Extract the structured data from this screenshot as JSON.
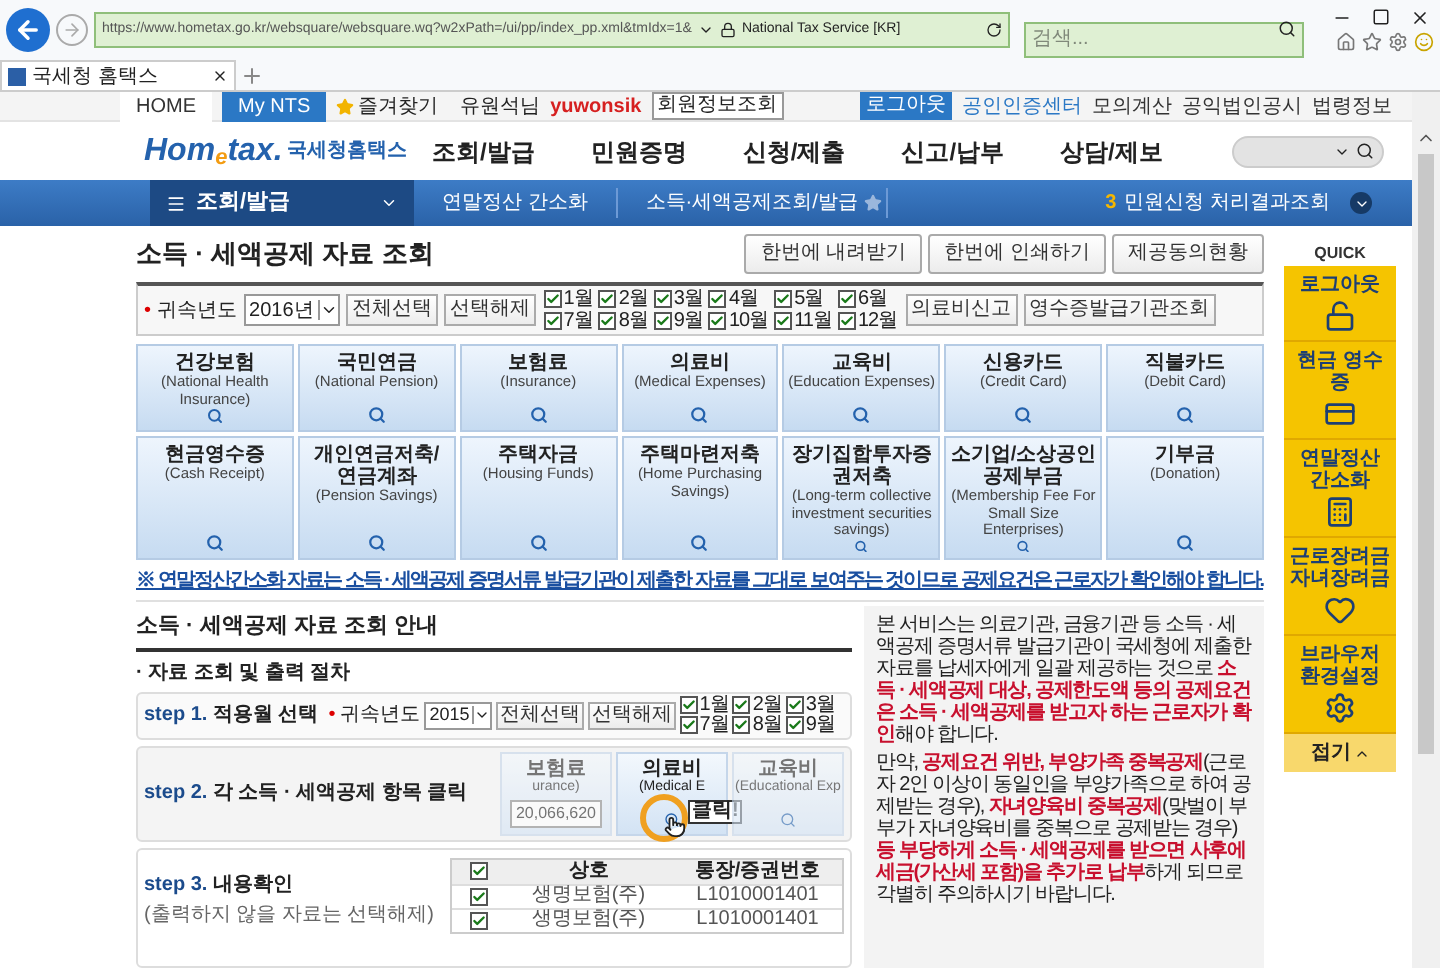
{
  "browser": {
    "url": "https://www.hometax.go.kr/websquare/websquare.wq?w2xPath=/ui/pp/index_pp.xml&tmIdx=1&",
    "site_identity": "National Tax Service [KR]",
    "search": {
      "placeholder": "검색..."
    },
    "tab": {
      "title": "국세청 홈택스"
    }
  },
  "top_bar": {
    "tabs": [
      {
        "label": "HOME",
        "selected": false
      },
      {
        "label": "My NTS",
        "selected": true
      }
    ],
    "favorites": "즐겨찾기",
    "user_name": "유원석님",
    "user_id": "yuwonsik",
    "profile_button": "회원정보조회",
    "logout_button": "로그아웃",
    "links": [
      "공인인증센터",
      "모의계산",
      "공익법인공시",
      "법령정보"
    ]
  },
  "header": {
    "logo": "Hom$_{e}$tax.",
    "logo_sub": "국세청홈택스",
    "menu": [
      "조회/발급",
      "민원증명",
      "신청/제출",
      "신고/납부",
      "상담/제보"
    ]
  },
  "nav": {
    "section": "조회/발급",
    "crumbs": [
      "연말정산 간소화",
      "소득·세액공제조회/발급"
    ],
    "badge": "3",
    "right_link": "민원신청 처리결과조회"
  },
  "page": {
    "title": "소득 · 세액공제 자료 조회",
    "actions": [
      "한번에 내려받기",
      "한번에 인쇄하기",
      "제공동의현황"
    ],
    "filter": {
      "bullet": "•",
      "label": "귀속년도",
      "year": "2016년",
      "buttons": [
        "전체선택",
        "선택해제"
      ],
      "months": [
        {
          "label": "1월",
          "checked": true
        },
        {
          "label": "2월",
          "checked": true
        },
        {
          "label": "3월",
          "checked": true
        },
        {
          "label": "4월",
          "checked": true
        },
        {
          "label": "5월",
          "checked": true
        },
        {
          "label": "6월",
          "checked": true
        },
        {
          "label": "7월",
          "checked": true
        },
        {
          "label": "8월",
          "checked": true
        },
        {
          "label": "9월",
          "checked": true
        },
        {
          "label": "10월",
          "checked": true
        },
        {
          "label": "11월",
          "checked": true
        },
        {
          "label": "12월",
          "checked": true
        }
      ],
      "extra_buttons": [
        "의료비신고",
        "영수증발급기관조회"
      ]
    },
    "categories": [
      {
        "name": "건강보험",
        "english": "(National Health Insurance)"
      },
      {
        "name": "국민연금",
        "english": "(National Pension)"
      },
      {
        "name": "보험료",
        "english": "(Insurance)"
      },
      {
        "name": "의료비",
        "english": "(Medical Expenses)"
      },
      {
        "name": "교육비",
        "english": "(Education Expenses)"
      },
      {
        "name": "신용카드",
        "english": "(Credit Card)"
      },
      {
        "name": "직불카드",
        "english": "(Debit Card)"
      },
      {
        "name": "현금영수증",
        "english": "(Cash Receipt)"
      },
      {
        "name": "개인연금저축/ 연금계좌",
        "english": "(Pension Savings)"
      },
      {
        "name": "주택자금",
        "english": "(Housing Funds)"
      },
      {
        "name": "주택마련저축",
        "english": "(Home Purchasing Savings)"
      },
      {
        "name": "장기집합투자증권저축",
        "english": "(Long-term collective investment securities savings)"
      },
      {
        "name": "소기업/소상공인 공제부금",
        "english": "(Membership Fee For Small Size Enterprises)"
      },
      {
        "name": "기부금",
        "english": "(Donation)"
      }
    ],
    "notice": "※ 연말정산간소화 자료는 소득 · 세액공제 증명서류 발급기관이 제출한 자료를 그대로 보여주는 것이므로 공제요건은 근로자가 확인해야 합니다."
  },
  "guide": {
    "title": "소득 · 세액공제 자료 조회 안내",
    "subtitle": "· 자료 조회 및 출력 절차",
    "step1": {
      "step": "step 1.",
      "label": "적용월 선택",
      "bullet": "•",
      "year_label": "귀속년도",
      "year": "2015",
      "buttons": [
        "전체선택",
        "선택해제"
      ],
      "months": [
        {
          "label": "1월",
          "checked": true
        },
        {
          "label": "2월",
          "checked": true
        },
        {
          "label": "3월",
          "checked": true
        },
        {
          "label": "7월",
          "checked": true
        },
        {
          "label": "8월",
          "checked": true
        },
        {
          "label": "9월",
          "checked": true
        }
      ]
    },
    "step2": {
      "step": "step 2.",
      "label": "각 소득 · 세액공제 항목 클릭",
      "tiles": [
        {
          "name": "보험료",
          "english": "urance)",
          "amount": "20,066,620"
        },
        {
          "name": "의료비",
          "english": "(Medical E"
        },
        {
          "name": "교육비",
          "english": "(Educational Exp"
        }
      ],
      "tooltip": "클릭!"
    },
    "step3": {
      "step": "step 3.",
      "label": "내용확인",
      "hint": "(출력하지 않을 자료는 선택해제)",
      "columns": [
        "상호",
        "통장/증권번호"
      ],
      "rows": [
        {
          "checked": true,
          "cells": [
            "생명보험(주)",
            "L1010001401"
          ]
        },
        {
          "checked": true,
          "cells": [
            "생명보험(주)",
            "L1010001401"
          ]
        }
      ],
      "header_checked": true
    }
  },
  "info_box": {
    "paragraphs": [
      "본 서비스는 의료기관, 금융기관 등 소득 · 세액공제 증명서류 발급기관이 국세청에 제출한 자료를 납세자에게 일괄 제공하는 것으로 **소득 · 세액공제 대상, 공제한도액 등의 공제요건은 소득 · 세액공제를 받고자 하는 근로자가 확인**해야 합니다.",
      "만약, **공제요건 위반, 부양가족 중복공제**(근로자 2인 이상이 동일인을 부양가족으로 하여 공제받는 경우), **자녀양육비 중복공제**(맞벌이 부부가 자녀양육비를 중복으로 공제받는 경우)**등 부당하게 소득 · 세액공제를 받으면 사후에 세금(가산세 포함)을 추가로 납부**하게 되므로 각별히 주의하시기 바랍니다."
    ]
  },
  "quick": {
    "title": "QUICK",
    "items": [
      {
        "label": "로그아웃",
        "kind": "lock"
      },
      {
        "label": "현금 영수증",
        "kind": "card"
      },
      {
        "label": "연말정산 간소화",
        "kind": "calculator"
      },
      {
        "label": "근로장려금 자녀장려금",
        "kind": "heart"
      },
      {
        "label": "브라우저 환경설정",
        "kind": "gear"
      }
    ],
    "collapse": "접기"
  }
}
